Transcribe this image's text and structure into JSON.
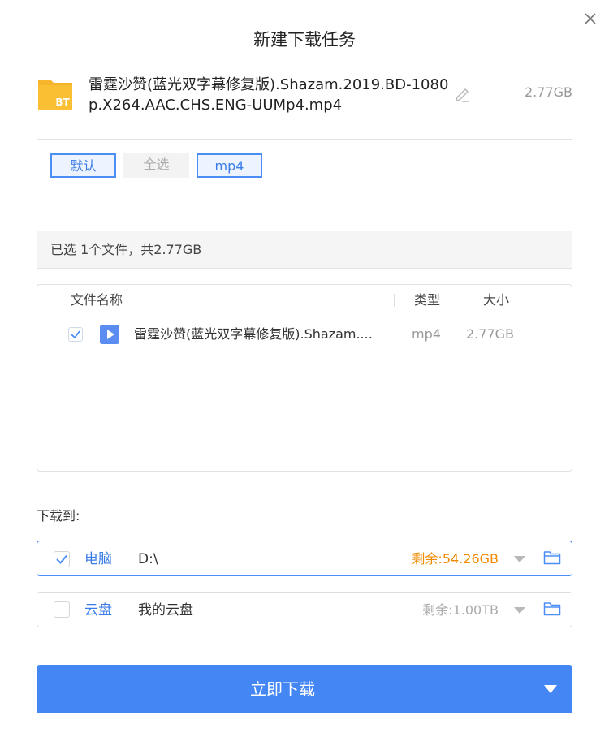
{
  "dialog": {
    "title": "新建下载任务"
  },
  "task": {
    "icon": "bt-file-icon",
    "icon_text": "BT",
    "name": "雷霆沙赞(蓝光双字幕修复版).Shazam.2019.BD-1080p.X264.AAC.CHS.ENG-UUMp4.mp4",
    "size": "2.77GB"
  },
  "filters": {
    "chips": [
      {
        "label": "默认",
        "active": true
      },
      {
        "label": "全选",
        "active": false
      },
      {
        "label": "mp4",
        "active": true
      }
    ],
    "summary": "已选 1个文件，共2.77GB"
  },
  "file_table": {
    "headers": {
      "name": "文件名称",
      "type": "类型",
      "size": "大小"
    },
    "rows": [
      {
        "checked": true,
        "icon": "video-play-icon",
        "name": "雷霆沙赞(蓝光双字幕修复版).Shazam....",
        "type": "mp4",
        "size": "2.77GB"
      }
    ]
  },
  "destination": {
    "label": "下载到:",
    "options": [
      {
        "name": "电脑",
        "path": "D:\\",
        "free": "剩余:54.26GB",
        "checked": true
      },
      {
        "name": "云盘",
        "path": "我的云盘",
        "free": "剩余:1.00TB",
        "checked": false
      }
    ]
  },
  "actions": {
    "download_label": "立即下载"
  },
  "colors": {
    "accent": "#4586f5",
    "warning": "#f08a00",
    "folder_yellow": "#f7b52c"
  }
}
